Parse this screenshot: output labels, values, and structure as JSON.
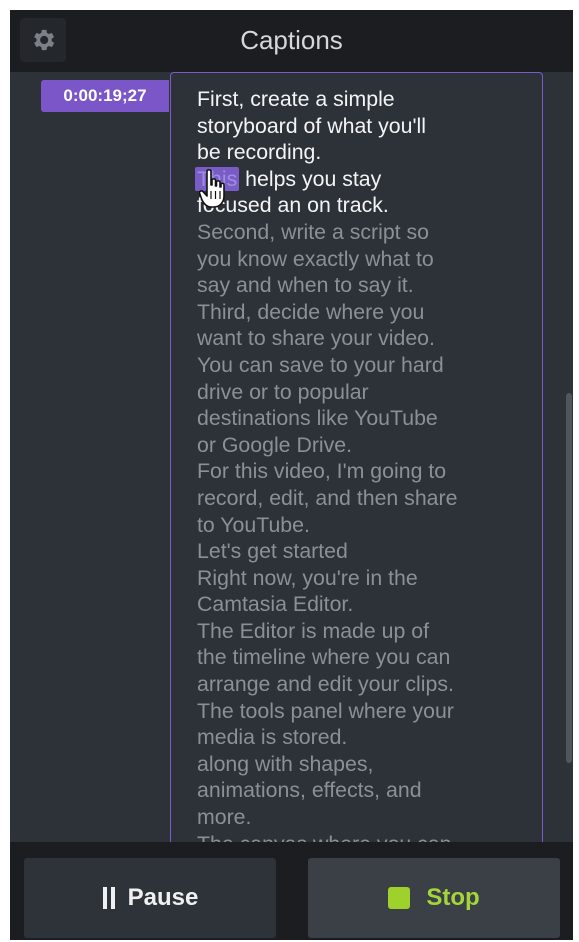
{
  "header": {
    "title": "Captions",
    "settings_icon": "gear-icon"
  },
  "caption": {
    "timestamp": "0:00:19;27",
    "highlighted_word": "This",
    "lines": [
      {
        "text": "First, create a simple",
        "state": "spoken"
      },
      {
        "text": "storyboard of what you'll",
        "state": "spoken"
      },
      {
        "text": "be recording.",
        "state": "spoken"
      },
      {
        "text": "This helps you stay",
        "state": "current"
      },
      {
        "text": "focused an on track.",
        "state": "spoken"
      },
      {
        "text": "Second, write a script so",
        "state": "upcoming"
      },
      {
        "text": "you know exactly what to",
        "state": "upcoming"
      },
      {
        "text": "say and when to say it.",
        "state": "upcoming"
      },
      {
        "text": "Third, decide where you",
        "state": "upcoming"
      },
      {
        "text": "want to share your video.",
        "state": "upcoming"
      },
      {
        "text": "You can save to your hard",
        "state": "upcoming"
      },
      {
        "text": "drive or to popular",
        "state": "upcoming"
      },
      {
        "text": "destinations like YouTube",
        "state": "upcoming"
      },
      {
        "text": "or Google Drive.",
        "state": "upcoming"
      },
      {
        "text": "For this video, I'm going to",
        "state": "upcoming"
      },
      {
        "text": "record, edit, and then share",
        "state": "upcoming"
      },
      {
        "text": "to YouTube.",
        "state": "upcoming"
      },
      {
        "text": "Let's get started",
        "state": "upcoming"
      },
      {
        "text": "Right now, you're in the",
        "state": "upcoming"
      },
      {
        "text": "Camtasia Editor.",
        "state": "upcoming"
      },
      {
        "text": "The Editor is made up of",
        "state": "upcoming"
      },
      {
        "text": "the timeline where you can",
        "state": "upcoming"
      },
      {
        "text": "arrange and edit your clips.",
        "state": "upcoming"
      },
      {
        "text": "The tools panel where your",
        "state": "upcoming"
      },
      {
        "text": "media is stored.",
        "state": "upcoming"
      },
      {
        "text": "along with shapes,",
        "state": "upcoming"
      },
      {
        "text": "animations, effects, and",
        "state": "upcoming"
      },
      {
        "text": "more.",
        "state": "upcoming"
      },
      {
        "text": "The canvas where you can",
        "state": "upcoming"
      }
    ]
  },
  "controls": {
    "pause_label": "Pause",
    "pause_icon": "pause-icon",
    "stop_label": "Stop",
    "stop_icon": "stop-icon"
  },
  "colors": {
    "panel_bg": "#2d3238",
    "header_bg": "#1b1d20",
    "accent_purple": "#7a5cc7",
    "spoken_text": "#f3f4f6",
    "upcoming_text": "#8c9096",
    "stop_green": "#9fd12d"
  }
}
